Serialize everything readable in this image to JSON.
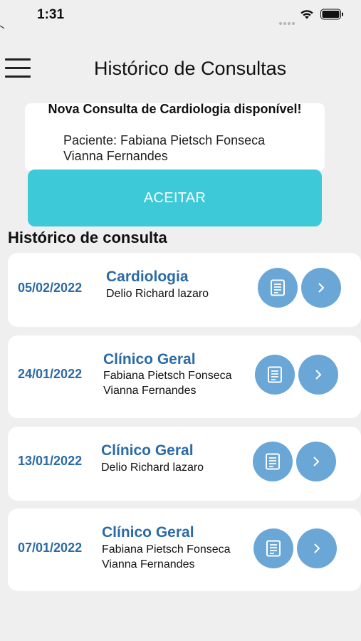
{
  "status_bar": {
    "time": "1:31"
  },
  "header": {
    "title": "Histórico de Consultas"
  },
  "notification": {
    "title": "Nova Consulta de Cardiologia disponível!",
    "patient": "Paciente: Fabiana Pietsch Fonseca Vianna Fernandes",
    "accept_label": "ACEITAR"
  },
  "history": {
    "title": "Histórico de consulta",
    "items": [
      {
        "date": "05/02/2022",
        "specialty": "Cardiologia",
        "doctor": "Delio Richard lazaro"
      },
      {
        "date": "24/01/2022",
        "specialty": "Clínico Geral",
        "doctor": "Fabiana Pietsch Fonseca Vianna Fernandes"
      },
      {
        "date": "13/01/2022",
        "specialty": "Clínico Geral",
        "doctor": "Delio Richard lazaro"
      },
      {
        "date": "07/01/2022",
        "specialty": "Clínico Geral",
        "doctor": "Fabiana Pietsch Fonseca Vianna Fernandes"
      }
    ]
  },
  "colors": {
    "accent": "#3ec9d9",
    "primary_text": "#2b6aa5",
    "button_circle": "#6aa7d6",
    "background": "#efefef"
  },
  "icons": {
    "menu": "hamburger-menu-icon",
    "document": "document-icon",
    "chevron": "chevron-right-icon"
  }
}
